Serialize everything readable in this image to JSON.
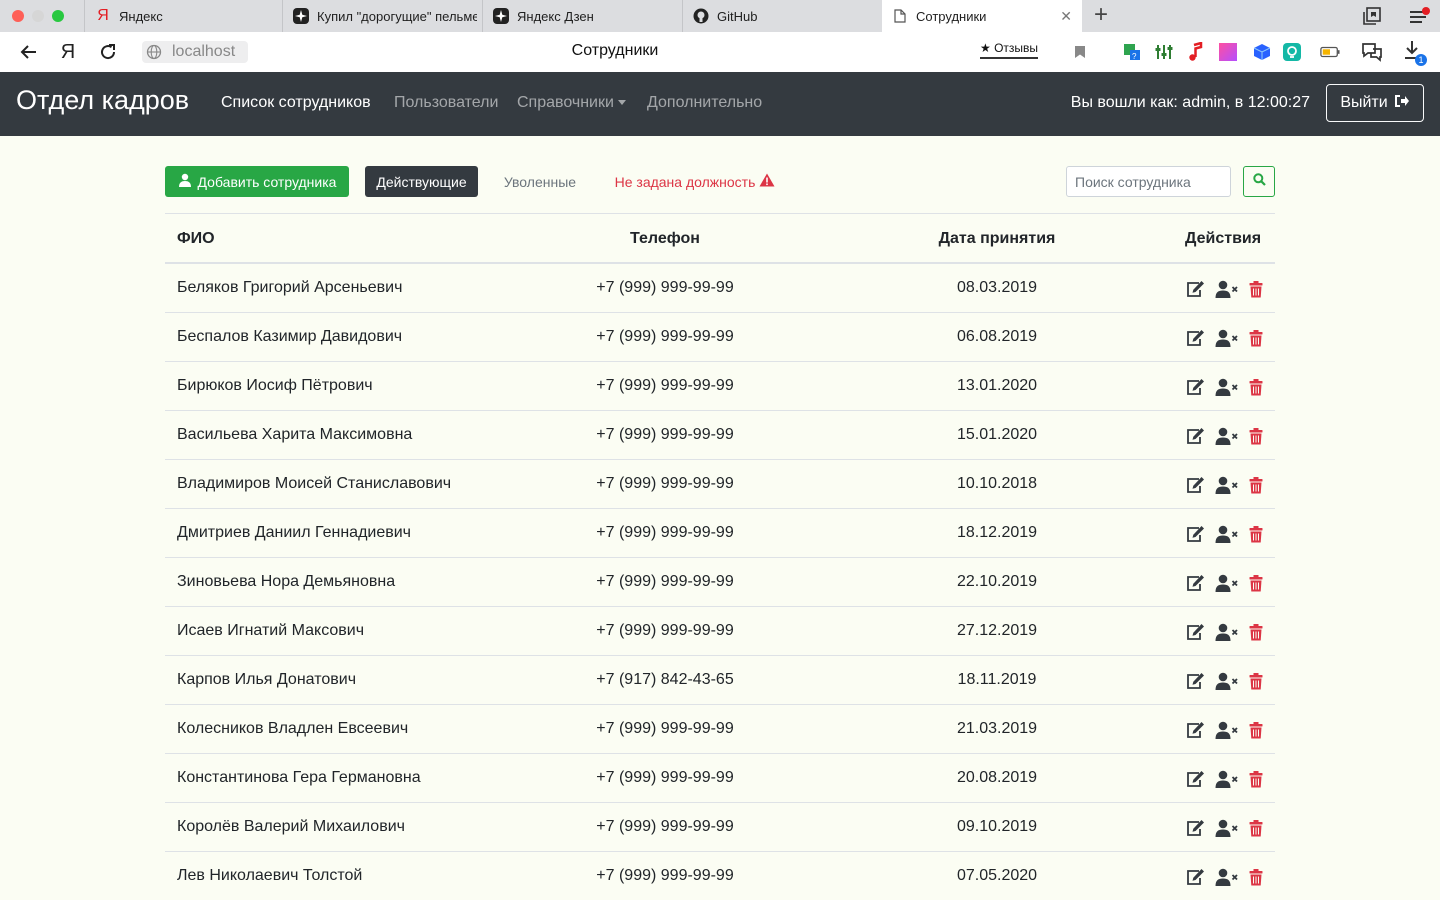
{
  "browser": {
    "tabs": [
      {
        "title": "Яндекс",
        "favicon": "yandex-icon"
      },
      {
        "title": "Купил \"дорогущие\" пельмени",
        "favicon": "zen-icon"
      },
      {
        "title": "Яндекс Дзен",
        "favicon": "zen-icon"
      },
      {
        "title": "GitHub",
        "favicon": "github-icon"
      },
      {
        "title": "Сотрудники",
        "favicon": "page-icon",
        "active": true
      }
    ],
    "address": "localhost",
    "page_title": "Сотрудники",
    "reviews_label": "★ Отзывы",
    "downloads_badge": "1"
  },
  "navbar": {
    "brand": "Отдел кадров",
    "links": [
      {
        "label": "Список сотрудников",
        "active": true
      },
      {
        "label": "Пользователи"
      },
      {
        "label": "Справочники",
        "dropdown": true
      },
      {
        "label": "Дополнительно"
      }
    ],
    "login_status": "Вы вошли как: admin, в 12:00:27",
    "logout_label": "Выйти"
  },
  "toolbar": {
    "add_label": "Добавить сотрудника",
    "filter_active": "Действующие",
    "filter_fired": "Уволенные",
    "filter_no_position": "Не задана должность",
    "search_placeholder": "Поиск сотрудника"
  },
  "colors": {
    "success": "#28a745",
    "danger": "#dc3545",
    "dark": "#343a40",
    "background": "#fbfdf3"
  },
  "table": {
    "headers": {
      "name": "ФИО",
      "phone": "Телефон",
      "date": "Дата принятия",
      "actions": "Действия"
    },
    "rows": [
      {
        "name": "Беляков Григорий Арсеньевич",
        "phone": "+7 (999) 999-99-99",
        "date": "08.03.2019"
      },
      {
        "name": "Беспалов Казимир Давидович",
        "phone": "+7 (999) 999-99-99",
        "date": "06.08.2019"
      },
      {
        "name": "Бирюков Иосиф Пётрович",
        "phone": "+7 (999) 999-99-99",
        "date": "13.01.2020"
      },
      {
        "name": "Васильева Харита Максимовна",
        "phone": "+7 (999) 999-99-99",
        "date": "15.01.2020"
      },
      {
        "name": "Владимиров Моисей Станиславович",
        "phone": "+7 (999) 999-99-99",
        "date": "10.10.2018"
      },
      {
        "name": "Дмитриев Даниил Геннадиевич",
        "phone": "+7 (999) 999-99-99",
        "date": "18.12.2019"
      },
      {
        "name": "Зиновьева Нора Демьяновна",
        "phone": "+7 (999) 999-99-99",
        "date": "22.10.2019"
      },
      {
        "name": "Исаев Игнатий Максович",
        "phone": "+7 (999) 999-99-99",
        "date": "27.12.2019"
      },
      {
        "name": "Карпов Илья Донатович",
        "phone": "+7 (917) 842-43-65",
        "date": "18.11.2019"
      },
      {
        "name": "Колесников Владлен Евсеевич",
        "phone": "+7 (999) 999-99-99",
        "date": "21.03.2019"
      },
      {
        "name": "Константинова Гера Германовна",
        "phone": "+7 (999) 999-99-99",
        "date": "20.08.2019"
      },
      {
        "name": "Королёв Валерий Михаилович",
        "phone": "+7 (999) 999-99-99",
        "date": "09.10.2019"
      },
      {
        "name": "Лев Николаевич Толстой",
        "phone": "+7 (999) 999-99-99",
        "date": "07.05.2020"
      }
    ]
  }
}
